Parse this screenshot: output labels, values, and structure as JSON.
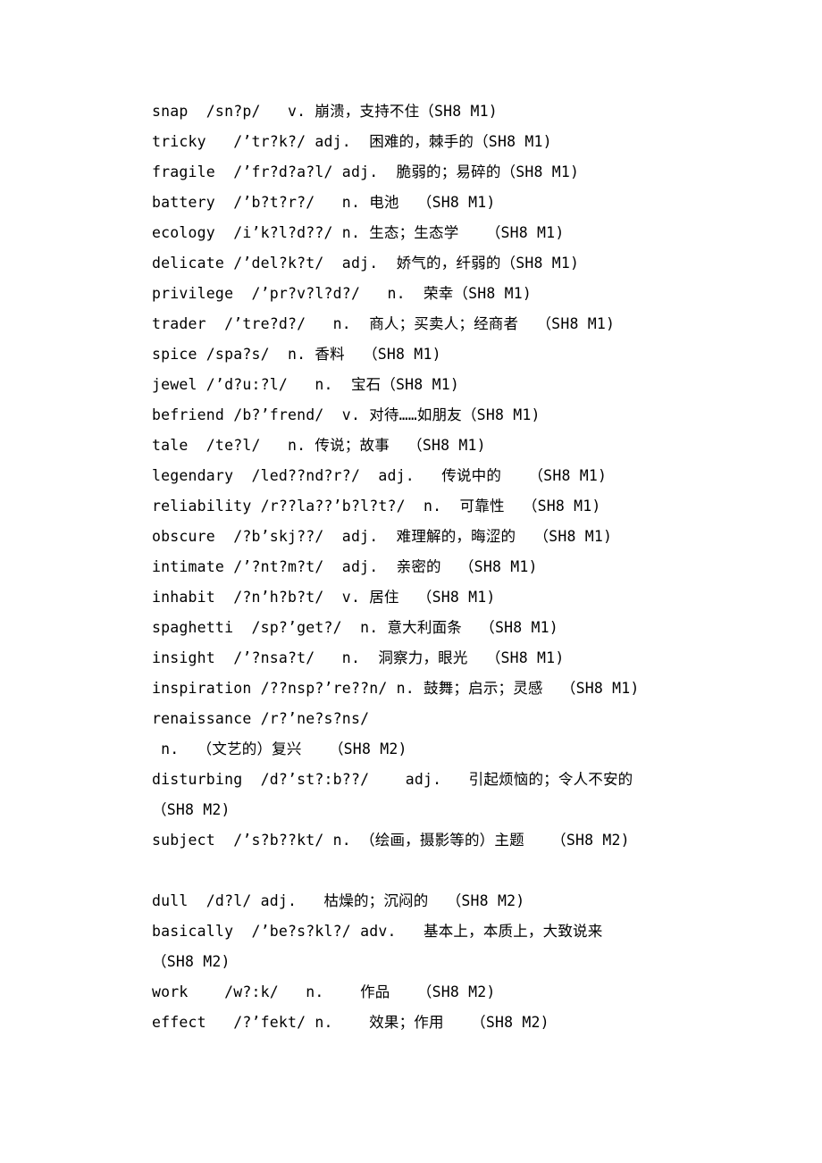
{
  "document": {
    "type": "vocabulary-word-list",
    "language_pair": "English-Chinese",
    "note_on_glyphs": "IPA phonetic symbols render as '?' placeholder characters in the source",
    "entries": [
      {
        "word": "snap",
        "phonetic": "/sn?p/",
        "pos": "v.",
        "definition": "崩溃，支持不住",
        "source": "(SH8 M1)",
        "line": "snap  /sn?p/   v. 崩溃，支持不住（SH8 M1)"
      },
      {
        "word": "tricky",
        "phonetic": "/’tr?k?/",
        "pos": "adj.",
        "definition": "困难的，棘手的",
        "source": "(SH8 M1)",
        "line": "tricky   /’tr?k?/ adj.  困难的，棘手的（SH8 M1)"
      },
      {
        "word": "fragile",
        "phonetic": "/’fr?d?a?l/",
        "pos": "adj.",
        "definition": "脆弱的；易碎的",
        "source": "(SH8 M1)",
        "line": "fragile  /’fr?d?a?l/ adj.  脆弱的；易碎的（SH8 M1)"
      },
      {
        "word": "battery",
        "phonetic": "/’b?t?r?/",
        "pos": "n.",
        "definition": "电池",
        "source": "(SH8 M1)",
        "line": "battery  /’b?t?r?/   n. 电池  （SH8 M1)"
      },
      {
        "word": "ecology",
        "phonetic": "/i’k?l?d??/",
        "pos": "n.",
        "definition": "生态；生态学",
        "source": "(SH8 M1)",
        "line": "ecology  /i’k?l?d??/ n. 生态；生态学   （SH8 M1)"
      },
      {
        "word": "delicate",
        "phonetic": "/’del?k?t/",
        "pos": "adj.",
        "definition": "娇气的，纤弱的",
        "source": "(SH8 M1)",
        "line": "delicate /’del?k?t/  adj.  娇气的，纤弱的（SH8 M1)"
      },
      {
        "word": "privilege",
        "phonetic": "/’pr?v?l?d?/",
        "pos": "n.",
        "definition": "荣幸",
        "source": "(SH8 M1)",
        "line": "privilege  /’pr?v?l?d?/   n.  荣幸（SH8 M1)"
      },
      {
        "word": "trader",
        "phonetic": "/’tre?d?/",
        "pos": "n.",
        "definition": "商人；买卖人；经商者",
        "source": "(SH8 M1)",
        "line": "trader  /’tre?d?/   n.  商人；买卖人；经商者  （SH8 M1)"
      },
      {
        "word": "spice",
        "phonetic": "/spa?s/",
        "pos": "n.",
        "definition": "香料",
        "source": "(SH8 M1)",
        "line": "spice /spa?s/  n. 香料  （SH8 M1)"
      },
      {
        "word": "jewel",
        "phonetic": "/’d?u:?l/",
        "pos": "n.",
        "definition": "宝石",
        "source": "(SH8 M1)",
        "line": "jewel /’d?u:?l/   n.  宝石（SH8 M1)"
      },
      {
        "word": "befriend",
        "phonetic": "/b?’frend/",
        "pos": "v.",
        "definition": "对待……如朋友",
        "source": "(SH8 M1)",
        "line": "befriend /b?’frend/  v. 对待……如朋友（SH8 M1)"
      },
      {
        "word": "tale",
        "phonetic": "/te?l/",
        "pos": "n.",
        "definition": "传说；故事",
        "source": "(SH8 M1)",
        "line": "tale  /te?l/   n. 传说；故事  （SH8 M1)"
      },
      {
        "word": "legendary",
        "phonetic": "/led??nd?r?/",
        "pos": "adj.",
        "definition": "传说中的",
        "source": "(SH8 M1)",
        "line": "legendary  /led??nd?r?/  adj.   传说中的   （SH8 M1)"
      },
      {
        "word": "reliability",
        "phonetic": "/r??la??’b?l?t?/",
        "pos": "n.",
        "definition": "可靠性",
        "source": "(SH8 M1)",
        "line": "reliability /r??la??’b?l?t?/  n.  可靠性  （SH8 M1)"
      },
      {
        "word": "obscure",
        "phonetic": "/?b’skj??/",
        "pos": "adj.",
        "definition": "难理解的，晦涩的",
        "source": "(SH8 M1)",
        "line": "obscure  /?b’skj??/  adj.  难理解的，晦涩的  （SH8 M1)"
      },
      {
        "word": "intimate",
        "phonetic": "/’?nt?m?t/",
        "pos": "adj.",
        "definition": "亲密的",
        "source": "(SH8 M1)",
        "line": "intimate /’?nt?m?t/  adj.  亲密的  （SH8 M1)"
      },
      {
        "word": "inhabit",
        "phonetic": "/?n’h?b?t/",
        "pos": "v.",
        "definition": "居住",
        "source": "(SH8 M1)",
        "line": "inhabit  /?n’h?b?t/  v. 居住  （SH8 M1)"
      },
      {
        "word": "spaghetti",
        "phonetic": "/sp?’get?/",
        "pos": "n.",
        "definition": "意大利面条",
        "source": "(SH8 M1)",
        "line": "spaghetti  /sp?’get?/  n. 意大利面条  （SH8 M1)"
      },
      {
        "word": "insight",
        "phonetic": "/’?nsa?t/",
        "pos": "n.",
        "definition": "洞察力，眼光",
        "source": "(SH8 M1)",
        "line": "insight  /’?nsa?t/   n.  洞察力，眼光  （SH8 M1)"
      },
      {
        "word": "inspiration",
        "phonetic": "/??nsp?’re??n/",
        "pos": "n.",
        "definition": "鼓舞；启示；灵感",
        "source": "(SH8 M1)",
        "line": "inspiration /??nsp?’re??n/ n. 鼓舞；启示；灵感  （SH8 M1)"
      },
      {
        "word": "renaissance",
        "phonetic": "/r?’ne?s?ns/",
        "pos": "n.",
        "definition": "（文艺的）复兴",
        "source": "(SH8 M2)",
        "line": "renaissance /r?’ne?s?ns/",
        "line2": " n.  （文艺的）复兴   （SH8 M2)"
      },
      {
        "word": "disturbing",
        "phonetic": "/d?’st?:b??/",
        "pos": "adj.",
        "definition": "引起烦恼的；令人不安的",
        "source": "(SH8 M2)",
        "line": "disturbing  /d?’st?:b??/    adj.   引起烦恼的；令人不安的",
        "line2": "（SH8 M2)"
      },
      {
        "word": "subject",
        "phonetic": "/’s?b??kt/",
        "pos": "n.",
        "definition": "（绘画，摄影等的）主题",
        "source": "(SH8 M2)",
        "line": "subject  /’s?b??kt/ n. （绘画，摄影等的）主题   （SH8 M2)"
      },
      {
        "word": "",
        "phonetic": "",
        "pos": "",
        "definition": "",
        "source": "",
        "line": ""
      },
      {
        "word": "dull",
        "phonetic": "/d?l/",
        "pos": "adj.",
        "definition": "枯燥的；沉闷的",
        "source": "(SH8 M2)",
        "line": "dull  /d?l/ adj.   枯燥的；沉闷的  （SH8 M2)"
      },
      {
        "word": "basically",
        "phonetic": "/’be?s?kl?/",
        "pos": "adv.",
        "definition": "基本上，本质上，大致说来",
        "source": "(SH8 M2)",
        "line": "basically  /’be?s?kl?/ adv.   基本上，本质上，大致说来",
        "line2": "（SH8 M2)"
      },
      {
        "word": "work",
        "phonetic": "/w?:k/",
        "pos": "n.",
        "definition": "作品",
        "source": "(SH8 M2)",
        "line": "work    /w?:k/   n.    作品   （SH8 M2)"
      },
      {
        "word": "effect",
        "phonetic": "/?’fekt/",
        "pos": "n.",
        "definition": "效果；作用",
        "source": "(SH8 M2)",
        "line": "effect   /?’fekt/ n.    效果；作用   （SH8 M2)"
      }
    ]
  }
}
